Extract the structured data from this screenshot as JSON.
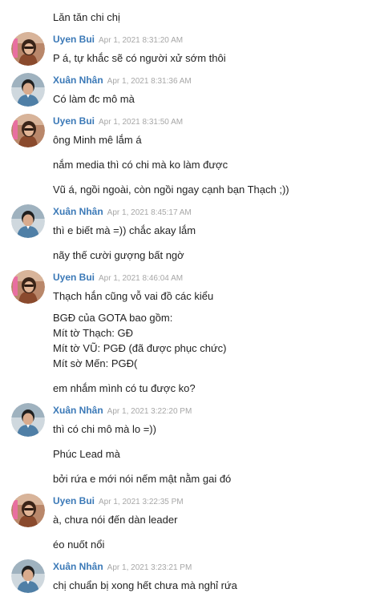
{
  "messages": {
    "m0": {
      "lines": [
        "Lăn tăn chi chị"
      ]
    },
    "g1": {
      "author": "Uyen Bui",
      "time": "Apr 1, 2021 8:31:20 AM",
      "avatar_icon": "woman-avatar-icon",
      "items": [
        {
          "lines": [
            "P á, tự khắc sẽ có người xử sớm thôi"
          ]
        }
      ]
    },
    "g2": {
      "author": "Xuân Nhân",
      "time": "Apr 1, 2021 8:31:36 AM",
      "avatar_icon": "man-avatar-icon",
      "items": [
        {
          "lines": [
            "Có làm đc mô mà"
          ]
        }
      ]
    },
    "g3": {
      "author": "Uyen Bui",
      "time": "Apr 1, 2021 8:31:50 AM",
      "avatar_icon": "woman-avatar-icon",
      "items": [
        {
          "lines": [
            "ông Minh mê lắm á"
          ]
        },
        {
          "lines": [
            "nắm media thì có chi mà ko làm được"
          ]
        },
        {
          "lines": [
            "Vũ á, ngồi ngoài, còn ngồi ngay cạnh bạn Thạch ;))"
          ]
        }
      ]
    },
    "g4": {
      "author": "Xuân Nhân",
      "time": "Apr 1, 2021 8:45:17 AM",
      "avatar_icon": "man-avatar-icon",
      "items": [
        {
          "lines": [
            "thì e biết mà =)) chắc akay lắm"
          ]
        },
        {
          "lines": [
            "nãy thế cười gượng bất ngờ"
          ]
        }
      ]
    },
    "g5": {
      "author": "Uyen Bui",
      "time": "Apr 1, 2021 8:46:04 AM",
      "avatar_icon": "woman-avatar-icon",
      "items": [
        {
          "lines": [
            "Thạch hắn cũng vỗ vai đồ các kiểu"
          ]
        },
        {
          "lines": [
            "BGĐ của GOTA bao gồm:",
            "Mít tờ Thạch: GĐ",
            "Mít tờ VŨ: PGĐ (đã được phục chức)",
            "Mít sờ Mến: PGĐ("
          ]
        },
        {
          "lines": [
            "em nhắm mình có tu được ko?"
          ]
        }
      ]
    },
    "g6": {
      "author": "Xuân Nhân",
      "time": "Apr 1, 2021 3:22:20 PM",
      "avatar_icon": "man-avatar-icon",
      "items": [
        {
          "lines": [
            "thì có chi mô mà lo =))"
          ]
        },
        {
          "lines": [
            "Phúc Lead mà"
          ]
        },
        {
          "lines": [
            "bởi rứa e mới nói nếm mật nằm gai đó"
          ]
        }
      ]
    },
    "g7": {
      "author": "Uyen Bui",
      "time": "Apr 1, 2021 3:22:35 PM",
      "avatar_icon": "woman-avatar-icon",
      "items": [
        {
          "lines": [
            "à, chưa nói đến dàn leader"
          ]
        },
        {
          "lines": [
            "éo nuốt nổi"
          ]
        }
      ]
    },
    "g8": {
      "author": "Xuân Nhân",
      "time": "Apr 1, 2021 3:23:21 PM",
      "avatar_icon": "man-avatar-icon",
      "items": [
        {
          "lines": [
            "chị chuẩn bị xong hết chưa mà nghỉ rứa"
          ]
        }
      ]
    }
  },
  "colors": {
    "author": "#3b79b7",
    "timestamp": "#a7a7a7",
    "text": "#222222",
    "background": "#ffffff"
  }
}
